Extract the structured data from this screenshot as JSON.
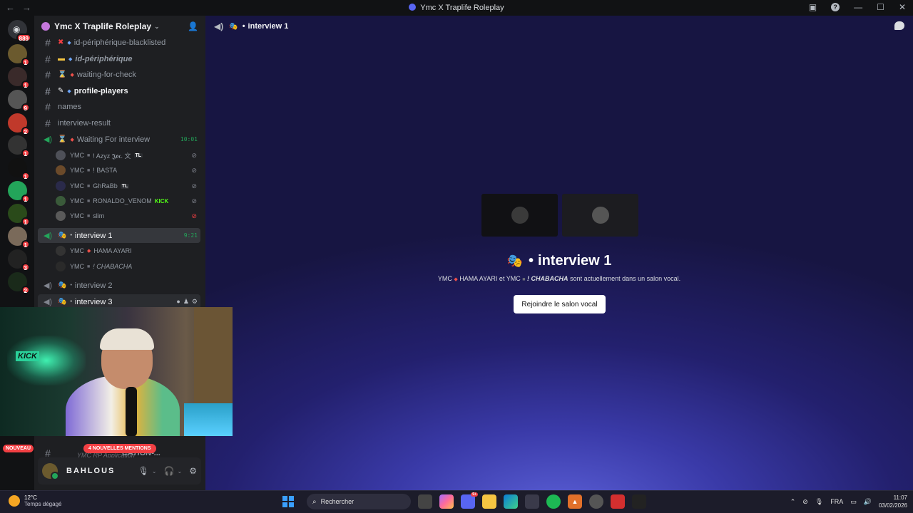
{
  "window": {
    "title": "Ymc X Traplife Roleplay"
  },
  "rail": {
    "home_badge": "889",
    "servers": [
      {
        "badge": "1",
        "color": "#6b5a2e"
      },
      {
        "badge": "1",
        "color": "#3a2a2a"
      },
      {
        "badge": "9",
        "color": "#555"
      },
      {
        "badge": "2",
        "color": "#c0392b"
      },
      {
        "badge": "1",
        "color": "#333"
      },
      {
        "badge": "1",
        "color": "#111"
      },
      {
        "badge": "1",
        "color": "#23a55a"
      },
      {
        "badge": "1",
        "color": "#2a4a1a"
      },
      {
        "badge": "1",
        "color": "#7a6a5a"
      },
      {
        "badge": "3",
        "color": "#222"
      },
      {
        "badge": "2",
        "color": "#1a2a1a"
      }
    ]
  },
  "guild": {
    "name": "Ymc X Traplife Roleplay"
  },
  "channels": {
    "c1": "id-périphérique-blacklisted",
    "c2": "id-périphérique",
    "c3": "waiting-for-check",
    "c4": "profile-players",
    "c5": "names",
    "c6": "interview-result",
    "v1": "Waiting For interview",
    "v1_timer": "10:01",
    "v2": "interview 1",
    "v2_timer": "9:21",
    "v3": "interview 2",
    "v4": "interview 3",
    "hidden1": "YMC RP Application",
    "hidden2": "CATION-..."
  },
  "voice_users": {
    "u1_prefix": "YMC",
    "u1_name": "! Azyz 𝕵𝖔𝖈. 文",
    "u1_tag": "TL",
    "u2_prefix": "YMC",
    "u2_name": "! BASTA",
    "u3_prefix": "YMC",
    "u3_name": "GhRaBb",
    "u3_tag": "TL",
    "u4_prefix": "YMC",
    "u4_name": "RONALDO_VENOM",
    "u4_tag": "KICK",
    "u5_prefix": "YMC",
    "u5_name": "slim",
    "u6_prefix": "YMC",
    "u6_name": "HAMA AYARI",
    "u7_prefix": "YMC",
    "u7_name": "! CHABACHA"
  },
  "user_panel": {
    "username": "BAHLOUS"
  },
  "pills": {
    "nouveau": "NOUVEAU",
    "mentions": "4 NOUVELLES MENTIONS"
  },
  "main": {
    "channel": "interview 1",
    "title": "interview 1",
    "subtitle_a": "YMC",
    "subtitle_b": "HAMA AYARI et YMC",
    "subtitle_c": "! CHABACHA",
    "subtitle_d": "sont actuellement dans un salon vocal.",
    "join_button": "Rejoindre le salon vocal"
  },
  "taskbar": {
    "temp": "12°C",
    "weather": "Temps dégagé",
    "search": "Rechercher",
    "lang": "FRA",
    "time": "11:07",
    "date": "03/02/2026",
    "discord_badge": "9+"
  }
}
